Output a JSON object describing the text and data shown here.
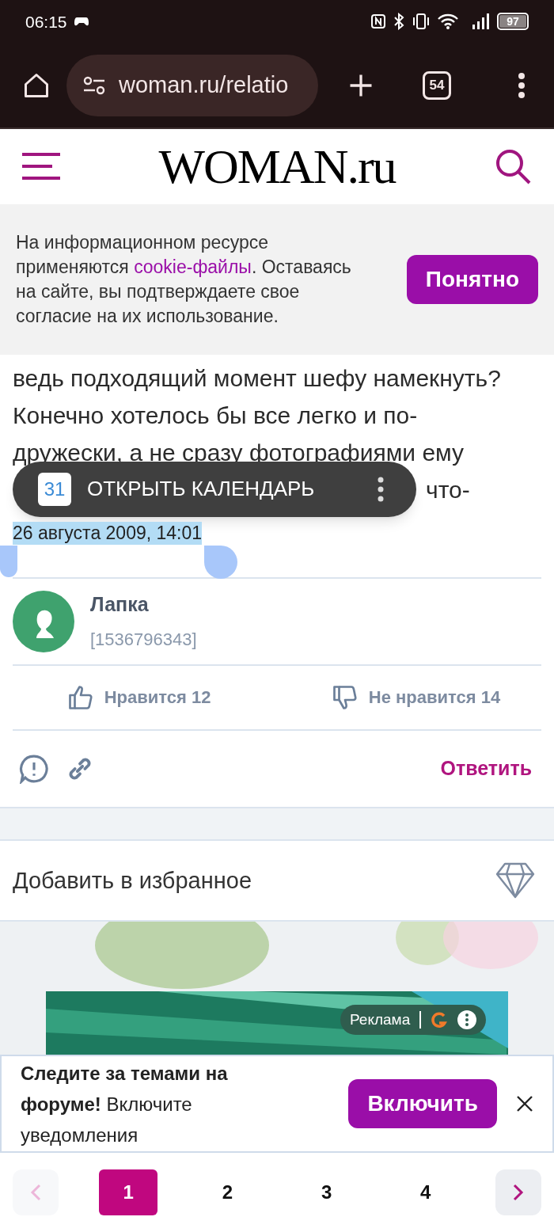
{
  "status_bar": {
    "time": "06:15",
    "battery": "97"
  },
  "browser": {
    "url": "woman.ru/relatio",
    "tab_count": "54"
  },
  "site_header": {
    "logo": "WOMAN.ru"
  },
  "cookie_banner": {
    "text_before": "На информационном ресурсе применяются ",
    "link": "cookie-файлы",
    "text_after": ". Оставаясь на сайте, вы подтверждаете свое согласие на их использование.",
    "button": "Понятно"
  },
  "post": {
    "lines": [
      "ведь подходящий момент шефу намекнуть?",
      "Конечно хотелось бы все легко и по-",
      "дружески, а не сразу фотографиями ему"
    ],
    "cut_fragment": "что-",
    "date": "26 августа 2009, 14:01",
    "date_highlighted": true
  },
  "calendar_popup": {
    "day": "31",
    "label": "ОТКРЫТЬ КАЛЕНДАРЬ"
  },
  "author": {
    "name": "Лапка",
    "id": "[1536796343]"
  },
  "reactions": [
    {
      "kind": "like",
      "label": "Нравится 12"
    },
    {
      "kind": "dislike",
      "label": "Не нравится 14"
    }
  ],
  "actions": {
    "reply": "Ответить"
  },
  "favorites": {
    "label": "Добавить в избранное"
  },
  "ad": {
    "label": "Реклама"
  },
  "notify_banner": {
    "text": "**Следите за темами на форуме!** Включите уведомления",
    "button": "Включить"
  },
  "pagination": {
    "prev_disabled": true,
    "pages": [
      {
        "label": "1",
        "selected": true
      },
      {
        "label": "2",
        "selected": false
      },
      {
        "label": "3",
        "selected": false
      },
      {
        "label": "4",
        "selected": false
      }
    ],
    "next_disabled": false
  }
}
